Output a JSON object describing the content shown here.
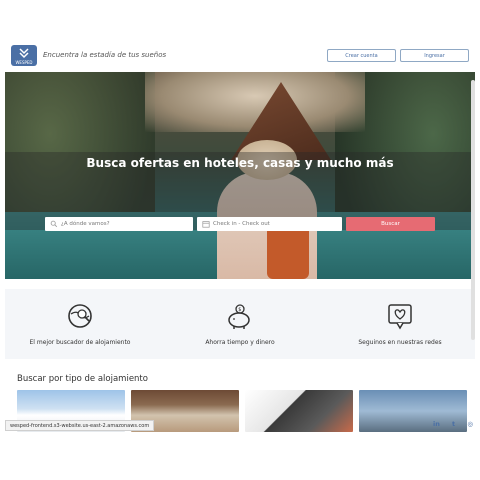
{
  "header": {
    "logo_label": "WESPED",
    "tagline": "Encuentra la estadía de tus sueños",
    "create_account_label": "Crear cuenta",
    "login_label": "Ingresar"
  },
  "hero": {
    "title": "Busca ofertas en hoteles, casas y mucho más",
    "destination_placeholder": "¿A dónde vamos?",
    "dates_placeholder": "Check in - Check out",
    "search_label": "Buscar"
  },
  "features": [
    {
      "icon": "globe-search-icon",
      "label": "El mejor buscador de alojamiento"
    },
    {
      "icon": "piggy-bank-icon",
      "label": "Ahorra tiempo y dinero"
    },
    {
      "icon": "heart-chat-icon",
      "label": "Seguinos en nuestras redes"
    }
  ],
  "accommodation": {
    "title": "Buscar por tipo de alojamiento"
  },
  "status_url": "wesped-frontend.s3-website.us-east-2.amazonaws.com",
  "social": {
    "linkedin_label": "in",
    "twitter_label": "t",
    "instagram_label": "◎"
  },
  "colors": {
    "brand": "#4a6fa5",
    "search_button": "#e66b73",
    "features_bg": "#f4f6f9"
  }
}
